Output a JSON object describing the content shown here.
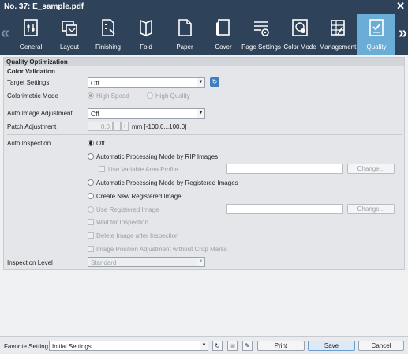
{
  "window": {
    "title": "No. 37: E_sample.pdf"
  },
  "tabs": [
    {
      "label": "General"
    },
    {
      "label": "Layout"
    },
    {
      "label": "Finishing"
    },
    {
      "label": "Fold"
    },
    {
      "label": "Paper"
    },
    {
      "label": "Cover"
    },
    {
      "label": "Page Settings"
    },
    {
      "label": "Color Mode"
    },
    {
      "label": "Management"
    },
    {
      "label": "Quality"
    }
  ],
  "active_tab": "Quality",
  "section": {
    "title": "Quality Optimization",
    "color_validation": {
      "title": "Color Validation",
      "target_label": "Target Settings",
      "target_value": "Off",
      "colorimetric_label": "Colorimetric Mode",
      "high_speed": "High Speed",
      "high_quality": "High Quality"
    },
    "auto_image_adjustment": {
      "label": "Auto Image Adjustment",
      "value": "Off"
    },
    "patch_adjustment": {
      "label": "Patch Adjustment",
      "value": "0.0",
      "minus": "−",
      "plus": "+",
      "unit": "mm [-100.0...100.0]"
    },
    "auto_inspection": {
      "label": "Auto Inspection",
      "off": "Off",
      "rip_mode": "Automatic Processing Mode by RIP Images",
      "variable_area": "Use Variable Area Profile",
      "change1": "Change...",
      "registered_mode": "Automatic Processing Mode by Registered Images",
      "create_new": "Create New Registered Image",
      "use_registered": "Use Registered Image",
      "change2": "Change...",
      "wait": "Wait for Inspection",
      "delete_image": "Delete Image after Inspection",
      "position_adjust": "Image Position Adjustment without Crop Marks"
    },
    "inspection_level": {
      "label": "Inspection Level",
      "value": "Standard"
    }
  },
  "footer": {
    "favorite_label": "Favorite Setting",
    "favorite_value": "Initial Settings",
    "print": "Print",
    "save": "Save",
    "cancel": "Cancel"
  }
}
